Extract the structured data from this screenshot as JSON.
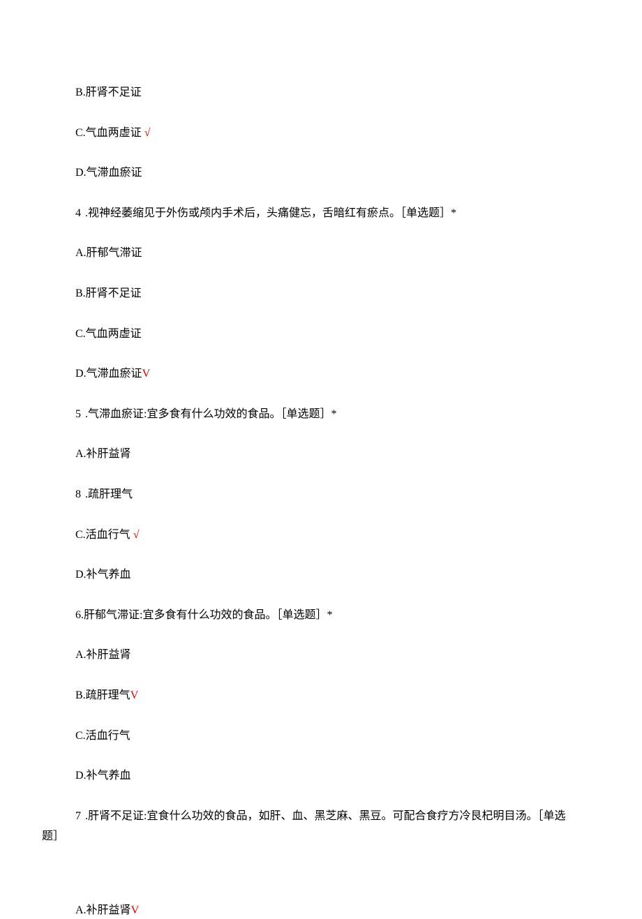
{
  "lines": {
    "optB_prev": "B.肝肾不足证",
    "optC_prev": "C.气血两虚证 ",
    "optC_prev_check": "√",
    "optD_prev": "D.气滞血瘀证",
    "q4_num": "4",
    "q4_text": " .视神经萎缩见于外伤或颅内手术后，头痛健忘，舌暗红有瘀点。［单选题］*",
    "q4_optA": "A.肝郁气滞证",
    "q4_optB": "B.肝肾不足证",
    "q4_optC": "C.气血两虚证",
    "q4_optD": "D.气滞血瘀证",
    "q4_optD_check": "V",
    "q5_num": "5",
    "q5_text": " .气滞血瘀证:宜多食有什么功效的食品。［单选题］*",
    "q5_optA": "A.补肝益肾",
    "q5_optB_num": "8",
    "q5_optB_text": " .疏肝理气",
    "q5_optC": "C.活血行气 ",
    "q5_optC_check": "√",
    "q5_optD": "D.补气养血",
    "q6_text": "6.肝郁气滞证:宜多食有什么功效的食品。［单选题］*",
    "q6_optA": "A.补肝益肾",
    "q6_optB": "B.疏肝理气",
    "q6_optB_check": "V",
    "q6_optC": "C.活血行气",
    "q6_optD": "D.补气养血",
    "q7_num": "7",
    "q7_text_line1": " .肝肾不足证:宜食什么功效的食品，如肝、血、黑芝麻、黑豆。可配合食疗方冷艮杞明目汤。［单选",
    "q7_text_line2": "题］",
    "q7_optA": "A.补肝益肾",
    "q7_optA_check": "V"
  }
}
